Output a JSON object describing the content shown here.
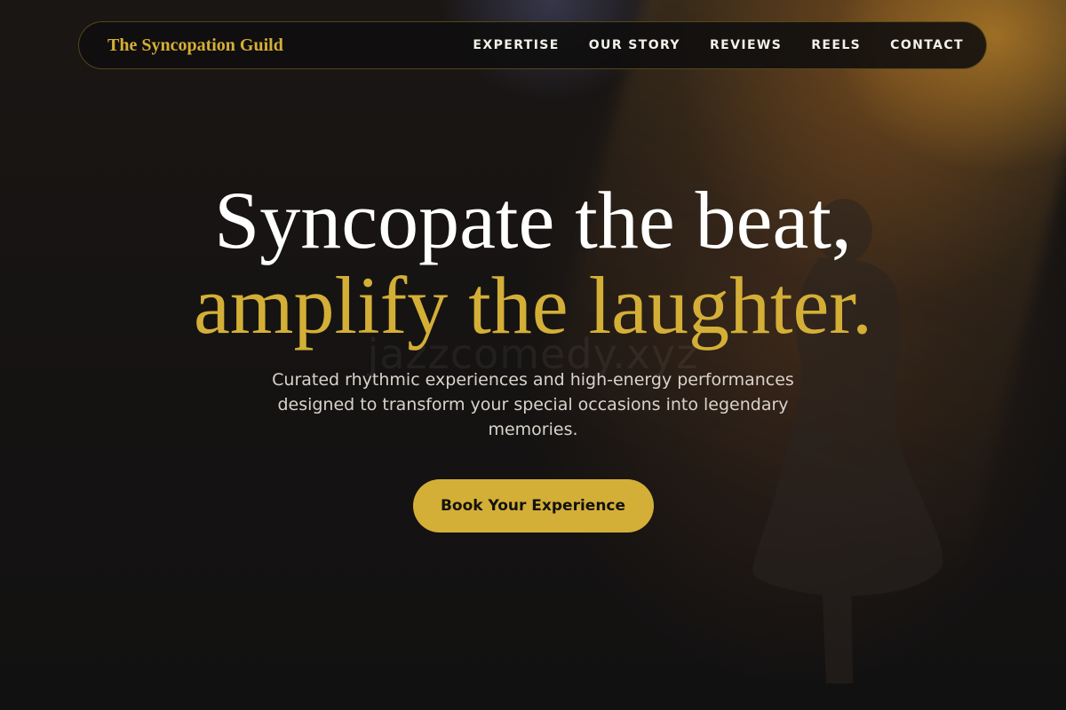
{
  "nav": {
    "brand": "The Syncopation Guild",
    "links": [
      "EXPERTISE",
      "OUR STORY",
      "REVIEWS",
      "REELS",
      "CONTACT"
    ]
  },
  "hero": {
    "headline_line1": "Syncopate the beat,",
    "headline_line2": "amplify the laughter.",
    "subtitle": "Curated rhythmic experiences and high-energy performances designed to transform your special occasions into legendary memories.",
    "cta_label": "Book Your Experience"
  },
  "watermark": "jazzcomedy.xyz",
  "colors": {
    "accent_gold": "#d4af37",
    "background": "#121111",
    "headline_white": "#ffffff"
  }
}
